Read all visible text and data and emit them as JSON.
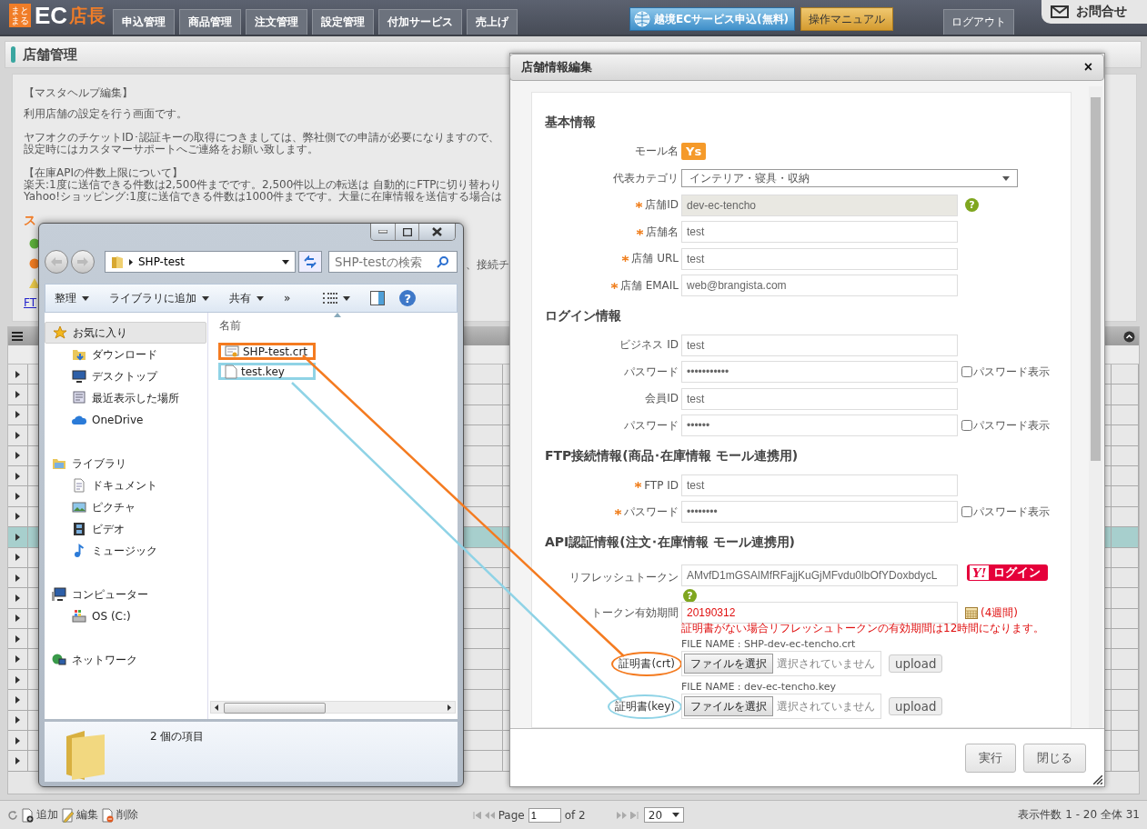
{
  "header": {
    "logo": {
      "badge": "まとまる",
      "main": "EC",
      "accent": "店長"
    },
    "tabs": [
      {
        "label": "申込管理",
        "selected": false
      },
      {
        "label": "商品管理",
        "selected": false
      },
      {
        "label": "注文管理",
        "selected": false
      },
      {
        "label": "設定管理",
        "selected": false
      },
      {
        "label": "付加サービス",
        "selected": false
      },
      {
        "label": "売上げ",
        "selected": false
      }
    ],
    "promo_button": "越境ECサービス申込(無料)",
    "manual_button": "操作マニュアル",
    "logout": "ログアウト",
    "contact": "お問合せ"
  },
  "page": {
    "title": "店舗管理",
    "help": {
      "heading": "【マスタヘルプ編集】",
      "paragraphs": [
        [
          "利用店舗の設定を行う画面です。"
        ],
        [
          "ヤフオクのチケットID･認証キーの取得につきましては、弊社側での申請が必要になりますので、",
          "設定時にはカスタマーサポートへご連絡をお願い致します。"
        ],
        [
          "【在庫APIの件数上限について】",
          "楽天:1度に送信できる件数は2,500件までです。2,500件以上の転送は 自動的にFTPに切り替わり",
          "Yahoo!ショッピング:1度に送信できる件数は1000件までです。大量に在庫情報を送信する場合は"
        ]
      ],
      "status_heading": "ス",
      "status_fragment": "、接続チ",
      "link": "FT"
    },
    "grid": {
      "rows": [
        {
          "selected": false
        },
        {
          "selected": false
        },
        {
          "selected": false
        },
        {
          "selected": false
        },
        {
          "selected": false
        },
        {
          "selected": false
        },
        {
          "selected": false
        },
        {
          "selected": false
        },
        {
          "selected": true
        },
        {
          "selected": false
        },
        {
          "selected": false
        },
        {
          "selected": false
        },
        {
          "selected": false
        },
        {
          "selected": false
        },
        {
          "selected": false
        },
        {
          "selected": false
        },
        {
          "selected": false
        },
        {
          "selected": false
        },
        {
          "selected": false
        },
        {
          "selected": false
        }
      ]
    },
    "pager": {
      "actions": [
        {
          "kind": "add",
          "label": "追加"
        },
        {
          "kind": "edit",
          "label": "編集"
        },
        {
          "kind": "delete",
          "label": "削除"
        }
      ],
      "page_label": "Page",
      "page": "1",
      "of": "of 2",
      "page_size": "20",
      "summary": "表示件数 1 - 20 全体 31"
    }
  },
  "explorer": {
    "address": "SHP-test",
    "search_placeholder": "SHP-testの検索",
    "toolbar": [
      {
        "label": "整理"
      },
      {
        "label": "ライブラリに追加"
      },
      {
        "label": "共有"
      }
    ],
    "more": "»",
    "help": "?",
    "nav": [
      {
        "label": "お気に入り",
        "kind": "star",
        "selected": true,
        "children": [
          {
            "label": "ダウンロード",
            "kind": "download",
            "selected": false
          },
          {
            "label": "デスクトップ",
            "kind": "desktop",
            "selected": false
          },
          {
            "label": "最近表示した場所",
            "kind": "recent",
            "selected": false
          },
          {
            "label": "OneDrive",
            "kind": "cloud",
            "selected": false
          }
        ]
      },
      {
        "label": "ライブラリ",
        "kind": "library",
        "selected": false,
        "children": [
          {
            "label": "ドキュメント",
            "kind": "document",
            "selected": false
          },
          {
            "label": "ピクチャ",
            "kind": "picture",
            "selected": false
          },
          {
            "label": "ビデオ",
            "kind": "video",
            "selected": false
          },
          {
            "label": "ミュージック",
            "kind": "music",
            "selected": false
          }
        ]
      },
      {
        "label": "コンピューター",
        "kind": "computer",
        "selected": false,
        "children": [
          {
            "label": "OS (C:)",
            "kind": "drive",
            "selected": false
          }
        ]
      },
      {
        "label": "ネットワーク",
        "kind": "network",
        "selected": false
      }
    ],
    "column": "名前",
    "files": [
      {
        "name": "SHP-test.crt",
        "kind": "certificate",
        "color": "#f47b20"
      },
      {
        "name": "test.key",
        "kind": "file",
        "color": "#8fd3e6"
      }
    ],
    "status": "2 個の項目"
  },
  "dialog": {
    "title": "店舗情報編集",
    "close": "×",
    "sections": [
      {
        "heading": "基本情報",
        "fields": [
          {
            "kind": "badge",
            "label": "モール名",
            "value": "Ys",
            "required": false
          },
          {
            "kind": "select",
            "label": "代表カテゴリ",
            "value": "インテリア・寝具・収納",
            "required": false
          },
          {
            "kind": "text",
            "label": "店舗ID",
            "value": "dev-ec-tencho",
            "required": true,
            "disabled": true,
            "help": "?"
          },
          {
            "kind": "text",
            "label": "店舗名",
            "value": "test",
            "required": true,
            "disabled": false
          },
          {
            "kind": "text",
            "label": "店舗 URL",
            "value": "test",
            "required": true,
            "disabled": false
          },
          {
            "kind": "text",
            "label": "店舗 EMAIL",
            "value": "web@brangista.com",
            "required": true,
            "disabled": false
          }
        ]
      },
      {
        "heading": "ログイン情報",
        "fields": [
          {
            "kind": "text",
            "label": "ビジネス ID",
            "value": "test",
            "required": false,
            "disabled": false
          },
          {
            "kind": "password",
            "label": "パスワード",
            "value": "•••••••••••",
            "required": false,
            "show_label": "パスワード表示",
            "show": false
          },
          {
            "kind": "text",
            "label": "会員ID",
            "value": "test",
            "required": false,
            "disabled": false
          },
          {
            "kind": "password",
            "label": "パスワード",
            "value": "••••••",
            "required": false,
            "show_label": "パスワード表示",
            "show": false
          }
        ]
      },
      {
        "heading": "FTP接続情報(商品･在庫情報 モール連携用)",
        "fields": [
          {
            "kind": "text",
            "label": "FTP ID",
            "value": "test",
            "required": true,
            "disabled": false
          },
          {
            "kind": "password",
            "label": "パスワード",
            "value": "••••••••",
            "required": true,
            "show_label": "パスワード表示",
            "show": false
          }
        ]
      },
      {
        "heading": "API認証情報(注文･在庫情報 モール連携用)",
        "fields": [
          {
            "kind": "token",
            "label": "リフレッシュトークン",
            "value": "AMvfD1mGSAlMfRFajjKuGjMFvdu0lbOfYDoxbdycL",
            "required": false,
            "login_logo": "Y!",
            "login": "ログイン",
            "help": "?"
          },
          {
            "kind": "date",
            "label": "トークン有効期間",
            "value": "20190312",
            "required": false,
            "note": "(4週間)",
            "warning": "証明書がない場合リフレッシュトークンの有効期間は12時間になります。"
          },
          {
            "kind": "file",
            "label": "証明書(crt)",
            "required": false,
            "filename": "FILE NAME : SHP-dev-ec-tencho.crt",
            "choose": "ファイルを選択",
            "status": "選択されていません",
            "upload": "upload",
            "color": "#f47b20"
          },
          {
            "kind": "file",
            "label": "証明書(key)",
            "required": false,
            "filename": "FILE NAME : dev-ec-tencho.key",
            "choose": "ファイルを選択",
            "status": "選択されていません",
            "upload": "upload",
            "color": "#8fd3e6"
          }
        ]
      }
    ],
    "buttons": [
      "実行",
      "閉じる"
    ]
  }
}
